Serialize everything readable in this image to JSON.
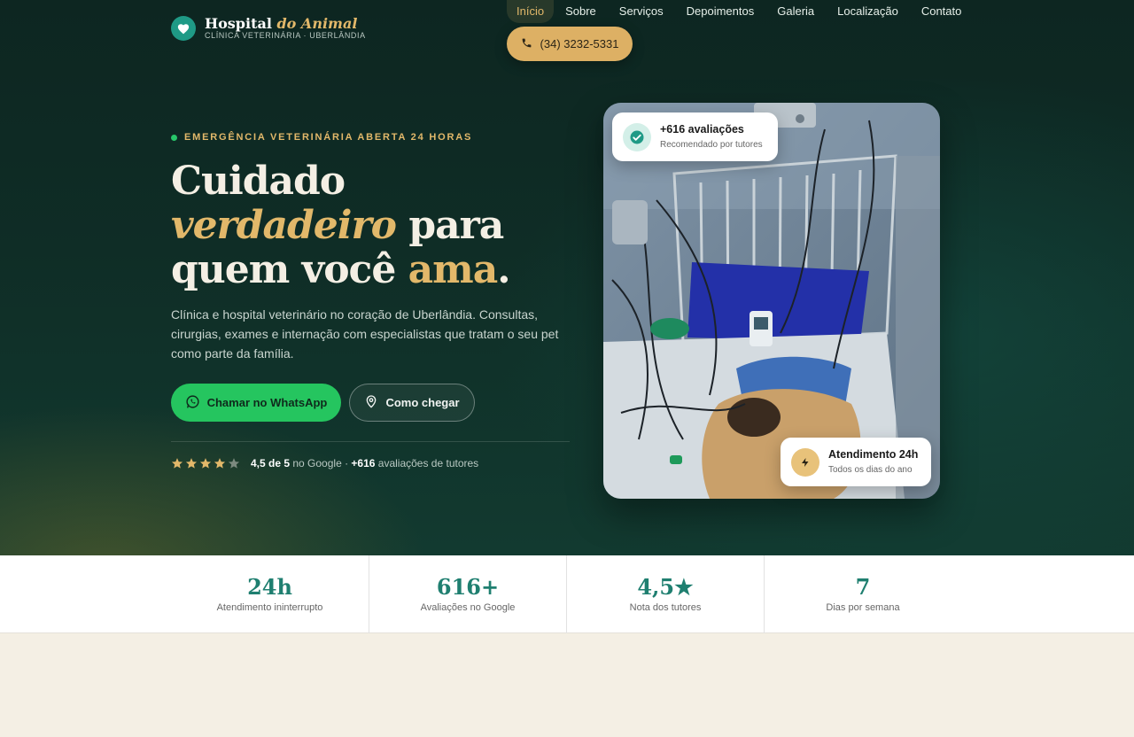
{
  "brand": {
    "name": "Hospital",
    "name_accent": "do Animal",
    "tagline": "CLÍNICA VETERINÁRIA · UBERLÂNDIA"
  },
  "nav": {
    "items": [
      "Início",
      "Sobre",
      "Serviços",
      "Depoimentos",
      "Galeria",
      "Localização",
      "Contato"
    ],
    "phone": "(34) 3232-5331"
  },
  "hero": {
    "eyebrow": "EMERGÊNCIA VETERINÁRIA ABERTA 24 HORAS",
    "headline": {
      "line1": "Cuidado",
      "line2_accent": "verdadeiro",
      "line2_rest": " para",
      "line3_start": "quem você ",
      "line3_accent": "ama",
      "line3_end": "."
    },
    "lead": "Clínica e hospital veterinário no coração de Uberlândia. Consultas, cirurgias, exames e internação com especialistas que tratam o seu pet como parte da família.",
    "cta_whatsapp": "Chamar no WhatsApp",
    "cta_directions": "Como chegar",
    "rating": {
      "stars": 4.5,
      "score": "4,5 de 5",
      "source": " no Google · ",
      "count": "+616",
      "count_label": " avaliações de tutores"
    }
  },
  "photo_badges": {
    "top": {
      "title": "+616 avaliações",
      "subtitle": "Recomendado por tutores"
    },
    "bottom": {
      "title": "Atendimento 24h",
      "subtitle": "Todos os dias do ano"
    }
  },
  "stats": [
    {
      "value": "24h",
      "label": "Atendimento ininterrupto"
    },
    {
      "value": "616+",
      "label": "Avaliações no Google"
    },
    {
      "value": "4,5★",
      "label": "Nota dos tutores"
    },
    {
      "value": "7",
      "label": "Dias por semana"
    }
  ],
  "colors": {
    "accent_gold": "#e2b86a",
    "whatsapp_green": "#25c55f",
    "teal": "#1f9a86",
    "hero_bg": "#0f2d26"
  }
}
